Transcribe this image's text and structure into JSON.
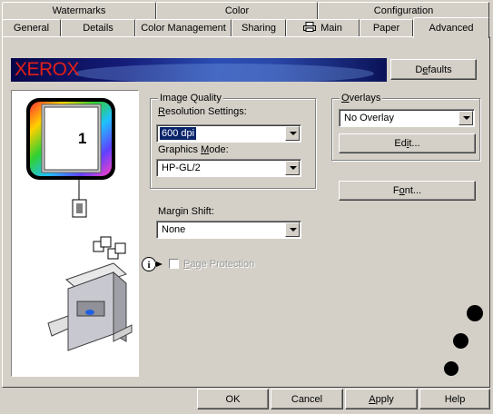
{
  "tabs": {
    "row1": [
      "Watermarks",
      "Color",
      "Configuration"
    ],
    "row2": [
      "General",
      "Details",
      "Color Management",
      "Sharing",
      "Main",
      "Paper",
      "Advanced"
    ],
    "active": "Advanced"
  },
  "brand": {
    "name": "XEROX"
  },
  "defaults_button": {
    "label_pre": "D",
    "label_u": "e",
    "label_post": "faults"
  },
  "preview": {
    "page_number": "1"
  },
  "image_quality": {
    "group_label": "Image Quality",
    "resolution": {
      "label_u": "R",
      "label_post": "esolution Settings:",
      "value": "600 dpi"
    },
    "graphics_mode": {
      "label_pre": "Graphics ",
      "label_u": "M",
      "label_post": "ode:",
      "value": "HP-GL/2"
    }
  },
  "margin_shift": {
    "label": "Margin Shift:",
    "value": "None"
  },
  "page_protection": {
    "label_u": "P",
    "label_post": "age Protection",
    "checked": false,
    "enabled": false
  },
  "overlays": {
    "group_label_u": "O",
    "group_label_post": "verlays",
    "value": "No Overlay",
    "edit_button": {
      "label_pre": "Ed",
      "label_u": "i",
      "label_post": "t..."
    }
  },
  "font_button": {
    "label_pre": "F",
    "label_u": "o",
    "label_post": "nt..."
  },
  "footer": {
    "ok": "OK",
    "cancel": "Cancel",
    "apply_u": "A",
    "apply_post": "pply",
    "help": "Help"
  },
  "icons": [
    "printer-glyph-icon",
    "info-icon",
    "stapler-icon",
    "copier-icon",
    "output-pages-icon"
  ],
  "colors": {
    "dialog_face": "#d4d0c8",
    "brand_red": "#e0201a",
    "selection": "#0a246a"
  }
}
